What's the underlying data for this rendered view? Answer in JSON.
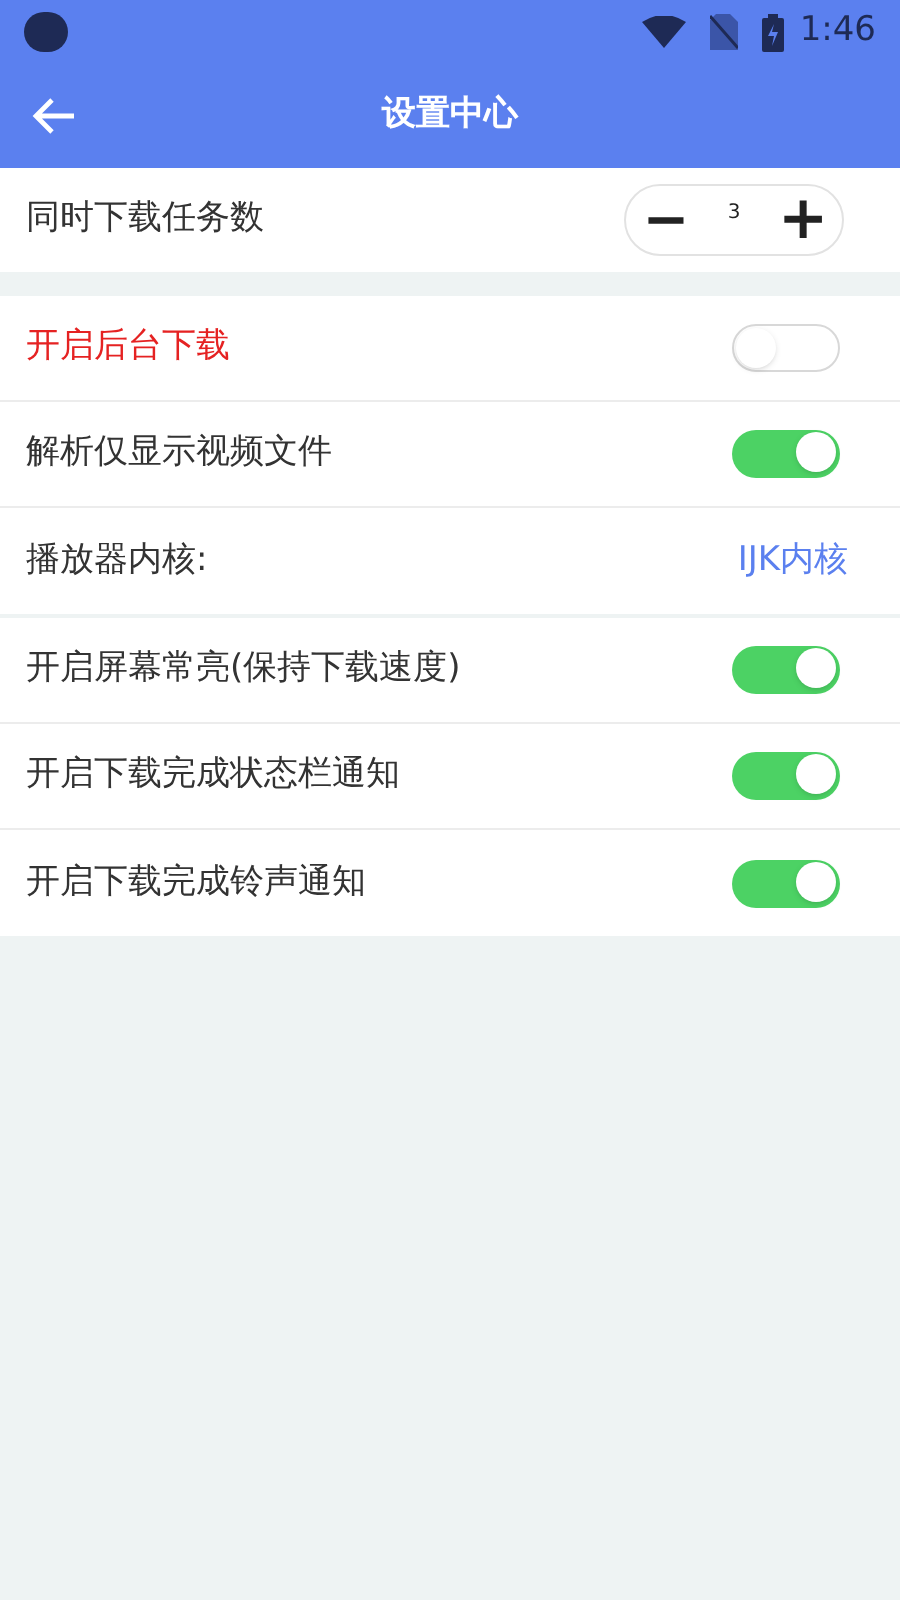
{
  "status_bar": {
    "time": "1:46"
  },
  "header": {
    "title": "设置中心"
  },
  "sections": [
    {
      "rows": [
        {
          "kind": "stepper",
          "label": "同时下载任务数",
          "warning": false,
          "minus": "−",
          "value": "3",
          "plus": "+"
        }
      ]
    },
    {
      "rows": [
        {
          "kind": "toggle",
          "label": "开启后台下载",
          "warning": true,
          "on": false
        },
        {
          "kind": "toggle",
          "label": "解析仅显示视频文件",
          "warning": false,
          "on": true
        },
        {
          "kind": "value",
          "label": "播放器内核:",
          "warning": false,
          "value": "IJK内核"
        }
      ]
    },
    {
      "rows": [
        {
          "kind": "toggle",
          "label": "开启屏幕常亮(保持下载速度)",
          "warning": false,
          "on": true
        },
        {
          "kind": "toggle",
          "label": "开启下载完成状态栏通知",
          "warning": false,
          "on": true
        },
        {
          "kind": "toggle",
          "label": "开启下载完成铃声通知",
          "warning": false,
          "on": true
        }
      ]
    }
  ]
}
